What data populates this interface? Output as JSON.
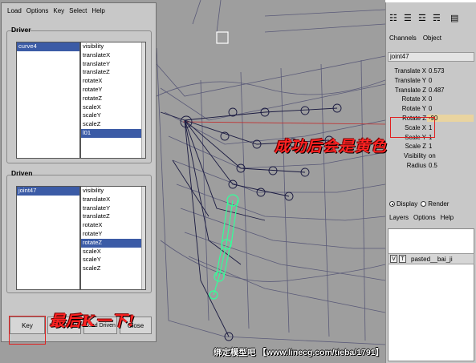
{
  "menu": [
    "Load",
    "Options",
    "Key",
    "Select",
    "Help"
  ],
  "driver": {
    "label": "Driver",
    "objects": [
      "curve4"
    ],
    "selected_object": 0,
    "attributes": [
      "visibility",
      "translateX",
      "translateY",
      "translateZ",
      "rotateX",
      "rotateY",
      "rotateZ",
      "scaleX",
      "scaleY",
      "scaleZ",
      "l01"
    ],
    "selected_attribute": 10
  },
  "driven": {
    "label": "Driven",
    "objects": [
      "joint47"
    ],
    "attributes": [
      "visibility",
      "translateX",
      "translateY",
      "translateZ",
      "rotateX",
      "rotateY",
      "rotateZ",
      "scaleX",
      "scaleY",
      "scaleZ"
    ],
    "selected_attribute": 6
  },
  "buttons": {
    "key": "Key",
    "load_driver": "Load Driver",
    "load_driven": "Load Driven",
    "close": "Close"
  },
  "channel_box": {
    "tabs": [
      "Channels",
      "Object"
    ],
    "object": "joint47",
    "attributes": [
      {
        "name": "Translate X",
        "value": "0.573"
      },
      {
        "name": "Translate Y",
        "value": "0"
      },
      {
        "name": "Translate Z",
        "value": "0.487"
      },
      {
        "name": "Rotate X",
        "value": "0"
      },
      {
        "name": "Rotate Y",
        "value": "0"
      },
      {
        "name": "Rotate Z",
        "value": "-90",
        "highlight": true
      },
      {
        "name": "Scale X",
        "value": "1"
      },
      {
        "name": "Scale Y",
        "value": "1"
      },
      {
        "name": "Scale Z",
        "value": "1"
      },
      {
        "name": "Visibility",
        "value": "on"
      },
      {
        "name": "Radius",
        "value": "0.5"
      }
    ]
  },
  "layer_editor": {
    "display_label": "Display",
    "render_label": "Render",
    "menu": [
      "Layers",
      "Options",
      "Help"
    ],
    "layer": {
      "v": "V",
      "t": "T",
      "name": "pasted__bai_ji"
    }
  },
  "annotations": {
    "key_note": "最后K一下!",
    "highlight_note": "成功后会是黄色"
  },
  "watermark": "绑定模型吧 【www.linecg.com/tieba/1791】",
  "colors": {
    "highlight_red": "#e02020",
    "selection_blue": "#3b5ba6",
    "keyed_yellow": "#e9d4a0",
    "joint_green": "#33ff99"
  }
}
